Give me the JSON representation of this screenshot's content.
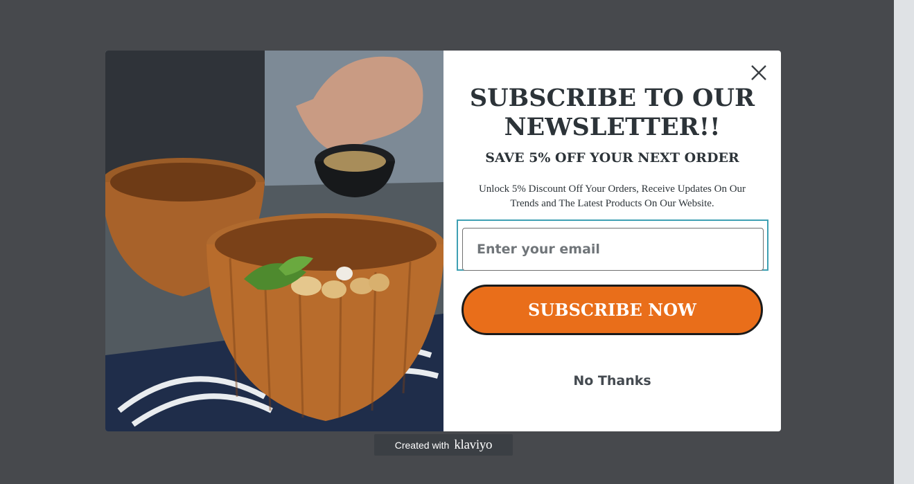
{
  "popup": {
    "headline": "SUBSCRIBE TO OUR NEWSLETTER!!",
    "subheadline": "SAVE 5% OFF YOUR NEXT ORDER",
    "description": "Unlock 5% Discount Off Your Orders, Receive Updates On Our Trends and The Latest Products On Our Website.",
    "email_placeholder": "Enter your email",
    "email_value": "",
    "subscribe_label": "SUBSCRIBE NOW",
    "decline_label": "No Thanks",
    "close_icon": "close-icon",
    "image_description": "wooden-bowls-photo"
  },
  "badge": {
    "created_with": "Created with",
    "brand": "klaviyo"
  },
  "colors": {
    "overlay": "#47494d",
    "accent": "#e96e1a",
    "input_focus": "#3ea0b3",
    "text": "#2c3338"
  }
}
